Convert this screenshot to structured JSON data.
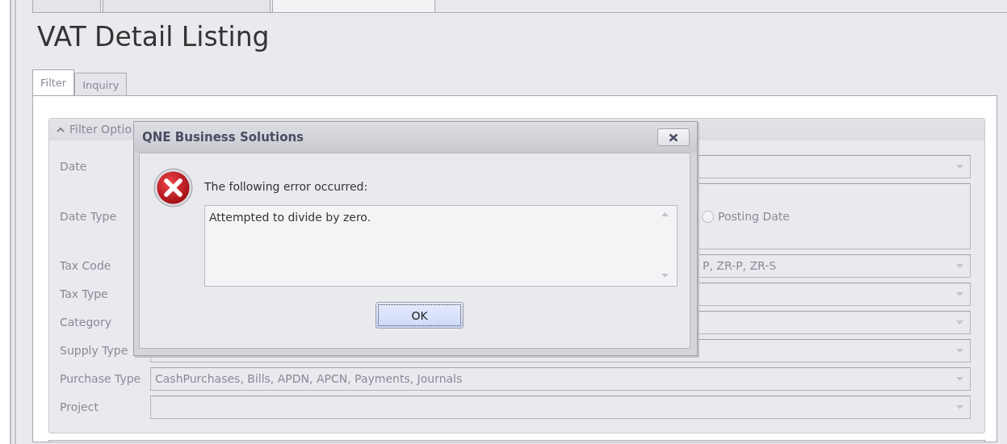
{
  "document_tabs": [
    {
      "selected": false
    },
    {
      "selected": false
    },
    {
      "selected": true
    }
  ],
  "title": "VAT Detail Listing",
  "tabs": [
    {
      "label": "Filter",
      "selected": true
    },
    {
      "label": "Inquiry",
      "selected": false
    }
  ],
  "filter_group": {
    "title": "Filter Optio",
    "expanded": true,
    "rows": [
      {
        "kind": "dropdown",
        "label": "Date"
      },
      {
        "kind": "radio",
        "label": "Date Type",
        "options": [
          {
            "label": "Posting Date",
            "selected": false
          }
        ]
      },
      {
        "kind": "dropdown-tail",
        "label": "Tax Code",
        "value": "P, ZR-P, ZR-S"
      },
      {
        "kind": "dropdown",
        "label": "Tax Type"
      },
      {
        "kind": "dropdown",
        "label": "Category"
      },
      {
        "kind": "dropdown",
        "label": "Supply Type"
      },
      {
        "kind": "dropdown",
        "label": "Purchase Type",
        "value": "CashPurchases, Bills, APDN, APCN, Payments, Journals"
      },
      {
        "kind": "dropdown",
        "label": "Project"
      }
    ]
  },
  "dialog": {
    "title": "QNE Business Solutions",
    "message": "The following error occurred:",
    "detail": "Attempted to divide by zero.",
    "buttons": [
      "OK"
    ]
  }
}
